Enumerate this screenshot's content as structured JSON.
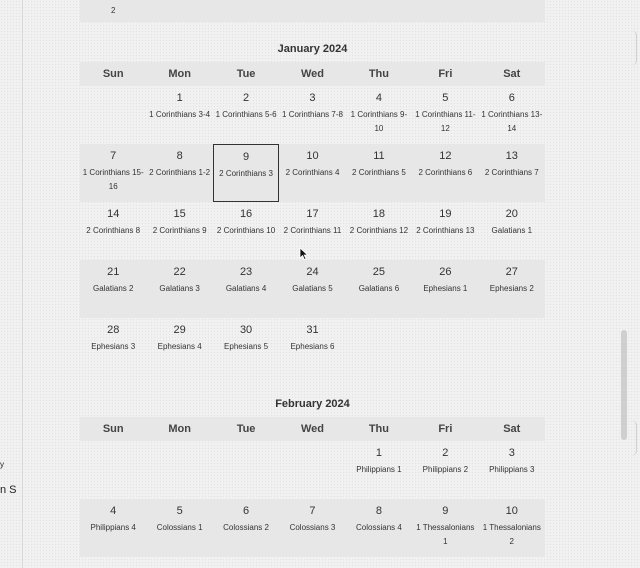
{
  "left_fragments": [
    "y",
    "n S"
  ],
  "prev_month_tail": {
    "text": "2"
  },
  "weekdays": [
    "Sun",
    "Mon",
    "Tue",
    "Wed",
    "Thu",
    "Fri",
    "Sat"
  ],
  "months": [
    {
      "title": "January 2024",
      "weeks": [
        [
          {
            "day": "",
            "reading": ""
          },
          {
            "day": "1",
            "reading": "1 Corinthians 3-4"
          },
          {
            "day": "2",
            "reading": "1 Corinthians 5-6"
          },
          {
            "day": "3",
            "reading": "1 Corinthians 7-8"
          },
          {
            "day": "4",
            "reading": "1 Corinthians 9-10"
          },
          {
            "day": "5",
            "reading": "1 Corinthians 11-12"
          },
          {
            "day": "6",
            "reading": "1 Corinthians 13-14"
          }
        ],
        [
          {
            "day": "7",
            "reading": "1 Corinthians 15-16"
          },
          {
            "day": "8",
            "reading": "2 Corinthians 1-2"
          },
          {
            "day": "9",
            "reading": "2 Corinthians 3",
            "today": true
          },
          {
            "day": "10",
            "reading": "2 Corinthians 4"
          },
          {
            "day": "11",
            "reading": "2 Corinthians 5"
          },
          {
            "day": "12",
            "reading": "2 Corinthians 6"
          },
          {
            "day": "13",
            "reading": "2 Corinthians 7"
          }
        ],
        [
          {
            "day": "14",
            "reading": "2 Corinthians 8"
          },
          {
            "day": "15",
            "reading": "2 Corinthians 9"
          },
          {
            "day": "16",
            "reading": "2 Corinthians 10"
          },
          {
            "day": "17",
            "reading": "2 Corinthians 11"
          },
          {
            "day": "18",
            "reading": "2 Corinthians 12"
          },
          {
            "day": "19",
            "reading": "2 Corinthians 13"
          },
          {
            "day": "20",
            "reading": "Galatians 1"
          }
        ],
        [
          {
            "day": "21",
            "reading": "Galatians 2"
          },
          {
            "day": "22",
            "reading": "Galatians 3"
          },
          {
            "day": "23",
            "reading": "Galatians 4"
          },
          {
            "day": "24",
            "reading": "Galatians 5"
          },
          {
            "day": "25",
            "reading": "Galatians 6"
          },
          {
            "day": "26",
            "reading": "Ephesians 1"
          },
          {
            "day": "27",
            "reading": "Ephesians 2"
          }
        ],
        [
          {
            "day": "28",
            "reading": "Ephesians 3"
          },
          {
            "day": "29",
            "reading": "Ephesians 4"
          },
          {
            "day": "30",
            "reading": "Ephesians 5"
          },
          {
            "day": "31",
            "reading": "Ephesians 6"
          },
          {
            "day": "",
            "reading": ""
          },
          {
            "day": "",
            "reading": ""
          },
          {
            "day": "",
            "reading": ""
          }
        ]
      ]
    },
    {
      "title": "February 2024",
      "weeks": [
        [
          {
            "day": "",
            "reading": ""
          },
          {
            "day": "",
            "reading": ""
          },
          {
            "day": "",
            "reading": ""
          },
          {
            "day": "",
            "reading": ""
          },
          {
            "day": "1",
            "reading": "Philippians 1"
          },
          {
            "day": "2",
            "reading": "Philippians 2"
          },
          {
            "day": "3",
            "reading": "Philippians 3"
          }
        ],
        [
          {
            "day": "4",
            "reading": "Philippians 4"
          },
          {
            "day": "5",
            "reading": "Colossians 1"
          },
          {
            "day": "6",
            "reading": "Colossians 2"
          },
          {
            "day": "7",
            "reading": "Colossians 3"
          },
          {
            "day": "8",
            "reading": "Colossians 4"
          },
          {
            "day": "9",
            "reading": "1 Thessalonians 1"
          },
          {
            "day": "10",
            "reading": "1 Thessalonians 2"
          }
        ]
      ]
    }
  ],
  "icons": {
    "cursor": "arrow-cursor-icon"
  }
}
